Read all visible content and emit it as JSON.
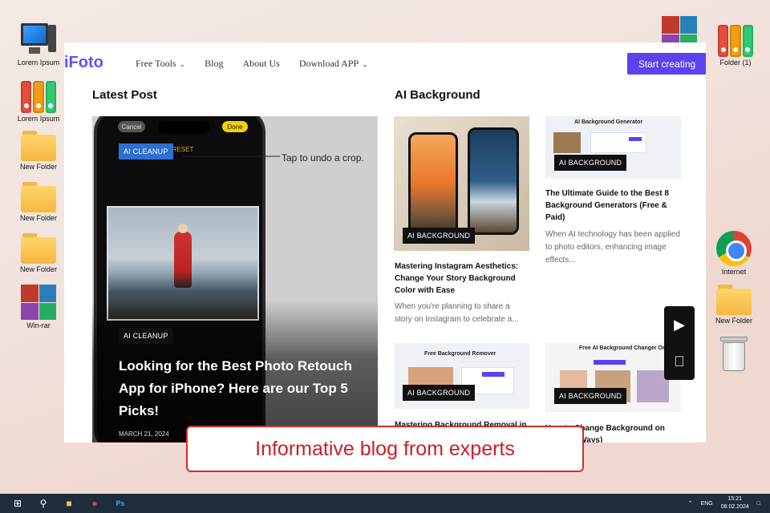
{
  "desktop": {
    "left_icons": [
      {
        "label": "Lorem Ipsum",
        "icon": "computer-icon"
      },
      {
        "label": "Lorem Ipsum",
        "icon": "binders-icon"
      },
      {
        "label": "New Folder",
        "icon": "folder-icon"
      },
      {
        "label": "New Folder",
        "icon": "folder-icon"
      },
      {
        "label": "New Folder",
        "icon": "folder-icon"
      },
      {
        "label": "Win-rar",
        "icon": "winrar-icon"
      }
    ],
    "right_icons": [
      {
        "label": "Folder (1)",
        "icon": "binders-icon"
      },
      {
        "label": "Internet",
        "icon": "chrome-icon"
      },
      {
        "label": "New Folder",
        "icon": "folder-icon"
      },
      {
        "label": "",
        "icon": "trash-icon"
      }
    ]
  },
  "site": {
    "logo": "iFoto",
    "nav": {
      "items": [
        "Free Tools",
        "Blog",
        "About Us",
        "Download APP"
      ],
      "cta": "Start creating"
    },
    "latest_title": "Latest Post",
    "ai_title": "AI Background",
    "hero": {
      "screen_cancel": "Cancel",
      "screen_done": "Done",
      "screen_reset": "RESET",
      "screen_tag": "AI CLEANUP",
      "callout": "Tap to undo a crop.",
      "tag": "AI CLEANUP",
      "title": "Looking for the Best Photo Retouch App for iPhone? Here are our Top 5 Picks!",
      "date": "MARCH 21, 2024"
    },
    "cards": [
      {
        "tag": "AI BACKGROUND",
        "title": "Mastering Instagram Aesthetics: Change Your Story Background Color with Ease",
        "excerpt": "When you're planning to share a story on Instagram to celebrate a..."
      },
      {
        "tag": "AI BACKGROUND",
        "thumb_heading": "AI Background Generator",
        "title": "The Ultimate Guide to the Best 8 Background Generators (Free & Paid)",
        "excerpt": "When AI technology has been applied to photo editors, enhancing image effects..."
      },
      {
        "tag": "AI BACKGROUND",
        "thumb_heading": "Free Background Remover",
        "title": "Mastering Background Removal in",
        "excerpt": ""
      },
      {
        "tag": "AI BACKGROUND",
        "thumb_heading": "Free AI Background Changer Online",
        "title": "How to Change Background on iPhone ( Ways)",
        "excerpt": ""
      }
    ],
    "stores": [
      "google-play-icon",
      "apple-icon"
    ]
  },
  "banner": "Informative blog from experts",
  "taskbar": {
    "lang": "ENG",
    "time": "15:21",
    "date": "08.02.2024"
  },
  "colors": {
    "brand": "#5b43f0",
    "banner_border": "#d62b2b",
    "taskbar": "#1f2d3d"
  }
}
